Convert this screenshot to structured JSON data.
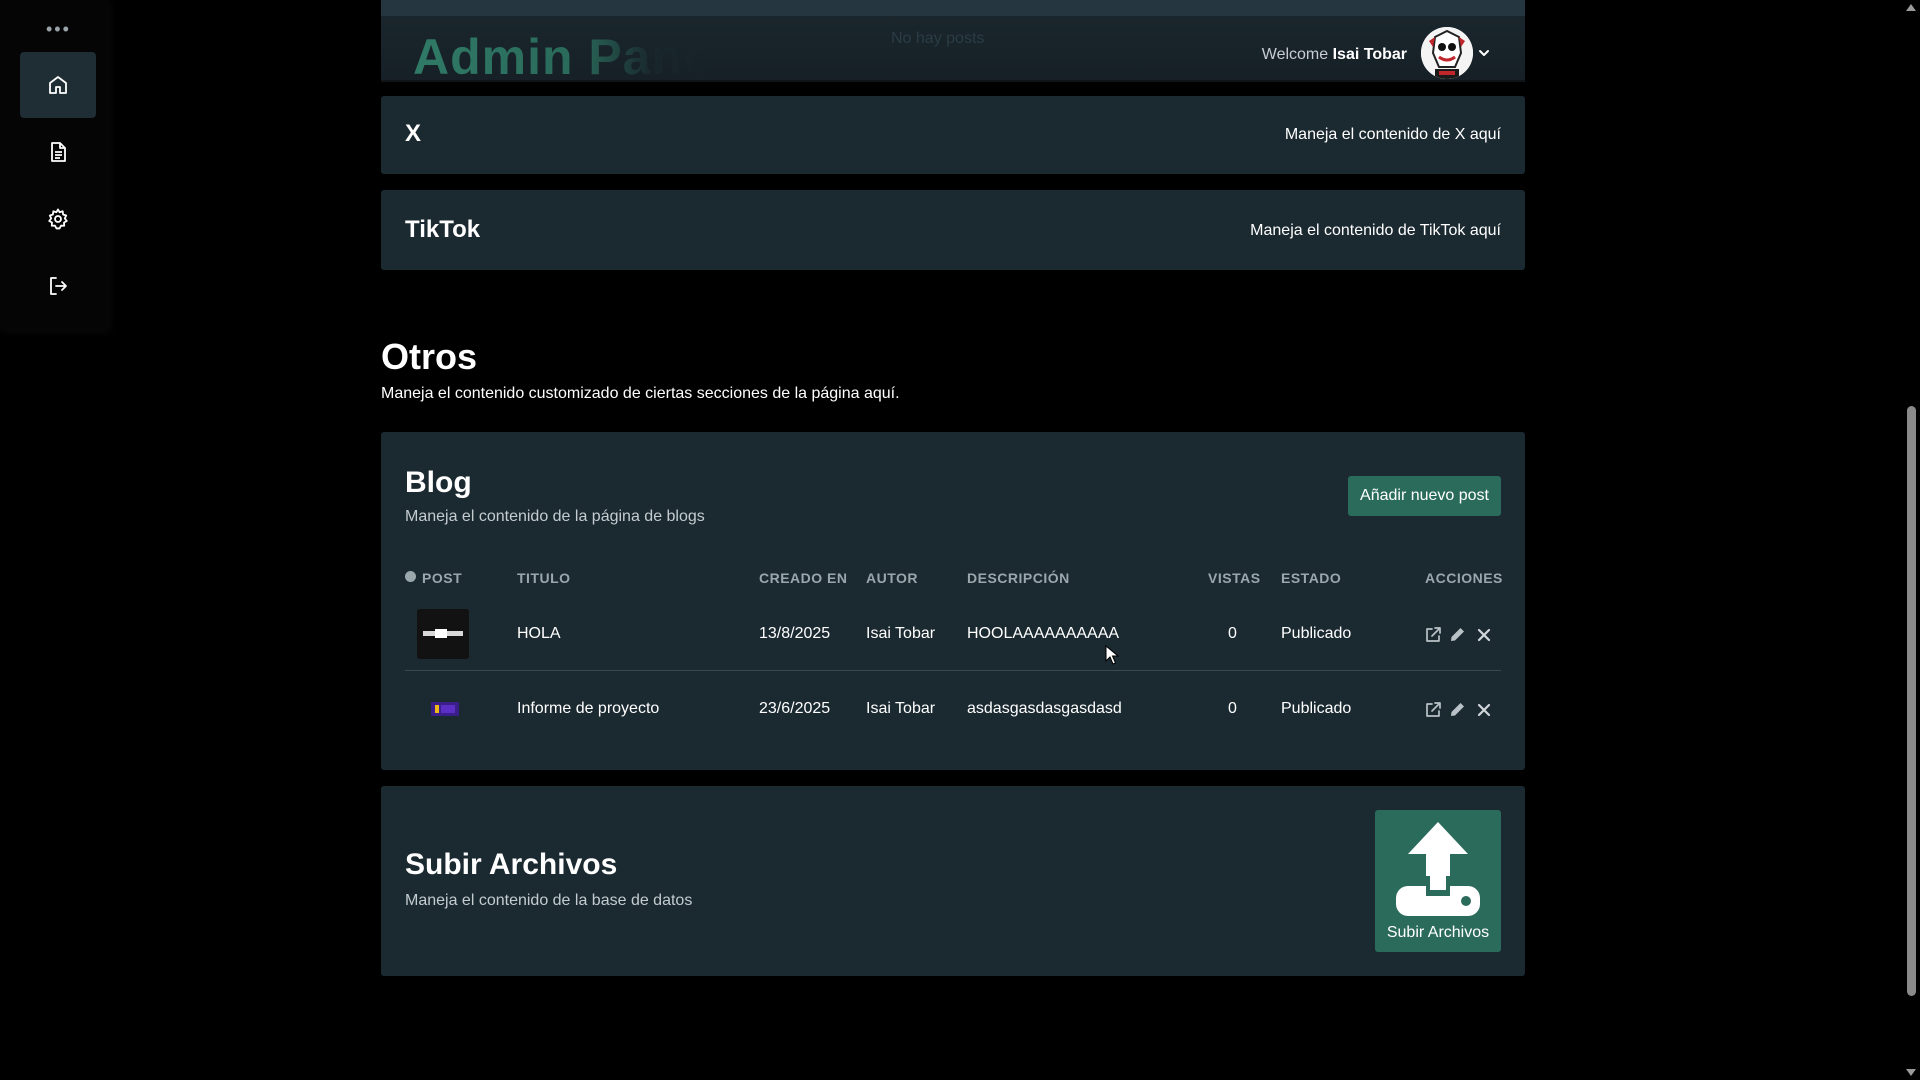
{
  "header": {
    "title": "Admin Panel",
    "faint_text": "No hay posts",
    "welcome_prefix": "Welcome",
    "user_name": "Isai Tobar"
  },
  "social": [
    {
      "title": "X",
      "description": "Maneja el contenido de X aquí"
    },
    {
      "title": "TikTok",
      "description": "Maneja el contenido de TikTok aquí"
    }
  ],
  "otros": {
    "title": "Otros",
    "description": "Maneja el contenido customizado de ciertas secciones de la página aquí."
  },
  "blog": {
    "title": "Blog",
    "description": "Maneja el contenido de la página de blogs",
    "add_button": "Añadir nuevo post",
    "columns": {
      "post": "POST",
      "titulo": "TITULO",
      "creado": "CREADO EN",
      "autor": "AUTOR",
      "descripcion": "DESCRIPCIÓN",
      "vistas": "VISTAS",
      "estado": "ESTADO",
      "acciones": "ACCIONES"
    },
    "rows": [
      {
        "titulo": "HOLA",
        "creado": "13/8/2025",
        "autor": "Isai Tobar",
        "descripcion": "HOOLAAAAAAAAAA",
        "vistas": "0",
        "estado": "Publicado"
      },
      {
        "titulo": "Informe de proyecto",
        "creado": "23/6/2025",
        "autor": "Isai Tobar",
        "descripcion": "asdasgasdasgasdasd",
        "vistas": "0",
        "estado": "Publicado"
      }
    ]
  },
  "upload": {
    "title": "Subir Archivos",
    "description": "Maneja el contenido de la base de datos",
    "button_label": "Subir Archivos"
  },
  "colors": {
    "panel": "#1b2931",
    "accent": "#2a6b5c",
    "sidebar_active": "#1f2d35"
  },
  "icons": {
    "sidebar": [
      "home-icon",
      "document-icon",
      "gear-icon",
      "logout-icon"
    ],
    "actions": [
      "external-link-icon",
      "pencil-icon",
      "close-icon"
    ]
  }
}
